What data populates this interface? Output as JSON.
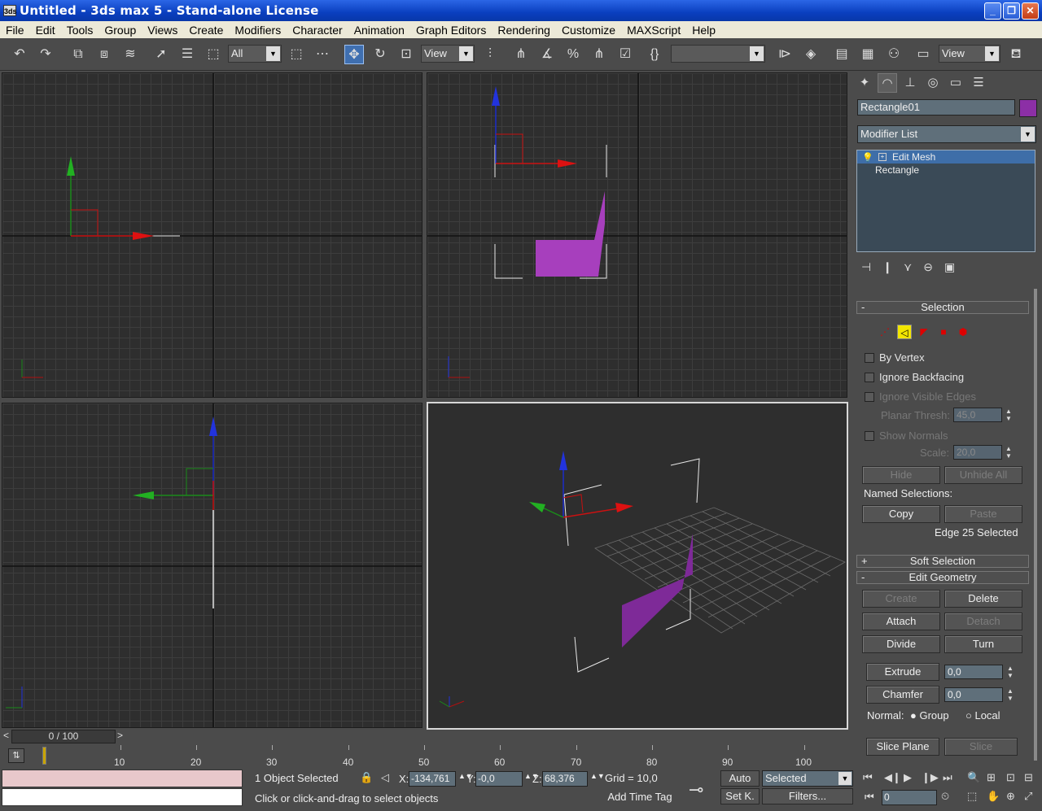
{
  "window": {
    "title": "Untitled  - 3ds max 5 - Stand-alone License",
    "icon_label": "3ds",
    "buttons": [
      "minimize-icon",
      "maximize-icon",
      "close-icon"
    ]
  },
  "menu": [
    "File",
    "Edit",
    "Tools",
    "Group",
    "Views",
    "Create",
    "Modifiers",
    "Character",
    "Animation",
    "Graph Editors",
    "Rendering",
    "Customize",
    "MAXScript",
    "Help"
  ],
  "toolbar": {
    "selection_filter": "All",
    "ref_coord": "View",
    "named_selection": "",
    "view_right": "View"
  },
  "colors": {
    "object": "#8c2fa6",
    "selection_highlight": "#3e6ea8",
    "active_frame": "#c9a400"
  },
  "command_panel": {
    "object_name": "Rectangle01",
    "modifier_list": "Modifier List",
    "stack": [
      "Edit Mesh",
      "Rectangle"
    ],
    "selection": {
      "title": "Selection",
      "by_vertex": "By Vertex",
      "ignore_backfacing": "Ignore Backfacing",
      "ignore_visible_edges": "Ignore Visible Edges",
      "planar_thresh_label": "Planar Thresh:",
      "planar_thresh_value": "45,0",
      "show_normals": "Show Normals",
      "scale_label": "Scale:",
      "scale_value": "20,0",
      "hide": "Hide",
      "unhide_all": "Unhide All",
      "named_selections": "Named Selections:",
      "copy": "Copy",
      "paste": "Paste",
      "status": "Edge 25 Selected"
    },
    "soft_selection": "Soft Selection",
    "edit_geometry": {
      "title": "Edit Geometry",
      "create": "Create",
      "delete": "Delete",
      "attach": "Attach",
      "detach": "Detach",
      "divide": "Divide",
      "turn": "Turn",
      "extrude": "Extrude",
      "extrude_value": "0,0",
      "chamfer": "Chamfer",
      "chamfer_value": "0,0",
      "normal_label": "Normal:",
      "group": "Group",
      "local": "Local",
      "slice_plane": "Slice Plane",
      "slice": "Slice"
    }
  },
  "timeline": {
    "frame_display": "0 / 100",
    "ticks": [
      "10",
      "20",
      "30",
      "40",
      "50",
      "60",
      "70",
      "80",
      "90",
      "100"
    ]
  },
  "status": {
    "selected": "1 Object Selected",
    "prompt": "Click or click-and-drag to select objects",
    "x_label": "X:",
    "x": "-134,761",
    "y_label": "Y:",
    "y": "-0,0",
    "z_label": "Z:",
    "z": "68,376",
    "grid": "Grid = 10,0",
    "add_time_tag": "Add Time Tag",
    "auto": "Auto",
    "set_key": "Set K.",
    "key_filter": "Selected",
    "filters": "Filters...",
    "current_frame": "0"
  }
}
